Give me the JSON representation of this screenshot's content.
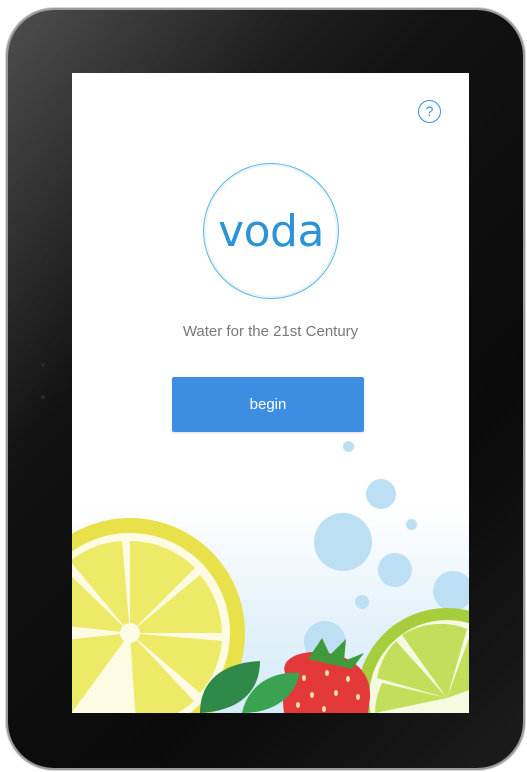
{
  "app": {
    "help_label": "?",
    "logo_text": "voda",
    "tagline": "Water for the 21st Century",
    "begin_label": "begin"
  },
  "colors": {
    "accent": "#3d8ee2",
    "logo_ring": "#5cb8ea",
    "logo_text": "#2b93d6",
    "bubble": "#bcdff4",
    "lemon": "#e8e14a",
    "lime": "#a6cd3c",
    "strawberry": "#e4393a",
    "leaf": "#2f8a4a"
  },
  "icons": {
    "help": "question-circle-icon",
    "logo": "voda-logo",
    "lemon": "lemon-slice-icon",
    "lime": "lime-slice-icon",
    "strawberry": "strawberry-icon",
    "mint": "mint-leaves-icon"
  }
}
